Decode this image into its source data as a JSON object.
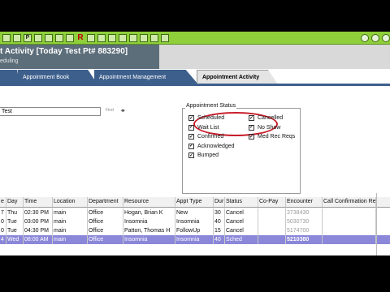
{
  "toolbar": {
    "icons": [
      "home-icon",
      "calendar-icon",
      "patient-icon",
      "chart-icon",
      "lock-icon",
      "pill-icon",
      "lab-icon",
      "rx-icon",
      "message-icon",
      "flag-icon",
      "print-icon",
      "fax-icon",
      "email-icon",
      "report-icon",
      "tasks-icon",
      "phone-icon",
      "document-icon",
      "user-icon",
      "exit-icon"
    ],
    "rx_label": "R",
    "p_label": "P"
  },
  "titlebar": {
    "title": "t Activity [Today Test  Pt# 883290]",
    "subtitle": "eduling"
  },
  "tabs": [
    {
      "label": ""
    },
    {
      "label": "Appointment Book"
    },
    {
      "label": "Appointment Management"
    },
    {
      "label": "Appointment Activity"
    }
  ],
  "search": {
    "value": "Test",
    "find_label": "Find"
  },
  "appt_status": {
    "title": "Appointment Status",
    "options_left": [
      {
        "label": "Scheduled",
        "checked": true
      },
      {
        "label": "Wait List",
        "checked": true
      },
      {
        "label": "Confirmed",
        "checked": true
      },
      {
        "label": "Acknowledged",
        "checked": true
      },
      {
        "label": "Bumped",
        "checked": true
      }
    ],
    "options_right": [
      {
        "label": "Cancelled",
        "checked": true
      },
      {
        "label": "No Show",
        "checked": true
      },
      {
        "label": "Med Rec Reqs",
        "checked": true
      }
    ]
  },
  "table": {
    "columns": [
      "e",
      "Day",
      "Time",
      "Location",
      "Department",
      "Resource",
      "Appt Type",
      "Dur",
      "Status",
      "Co-Pay",
      "Encounter",
      "Call Confirmation Re"
    ],
    "rows": [
      [
        "7",
        "Thu",
        "02:30 PM",
        "main",
        "Office",
        "Hogan, Brian K",
        "New",
        "30",
        "Cancel",
        "",
        "3738430",
        ""
      ],
      [
        "0",
        "Tue",
        "03:00 PM",
        "main",
        "Office",
        "Insomnia",
        "Insomnia",
        "40",
        "Cancel",
        "",
        "5030730",
        ""
      ],
      [
        "0",
        "Tue",
        "04:30 PM",
        "main",
        "Office",
        "Patton, Thomas H",
        "FollowUp",
        "15",
        "Cancel",
        "",
        "5174700",
        ""
      ],
      [
        "4",
        "Wed",
        "08:00 AM",
        "main",
        "Office",
        "Insomnia",
        "Insomnia",
        "40",
        "Sched",
        "",
        "5210380",
        ""
      ]
    ],
    "selected_row": 3
  },
  "colors": {
    "toolbar": "#8fcf3a",
    "title_block": "#5c6e7a",
    "tab": "#3d5f8c",
    "selected_row": "#8b87d9",
    "highlight": "#c81e2b"
  }
}
